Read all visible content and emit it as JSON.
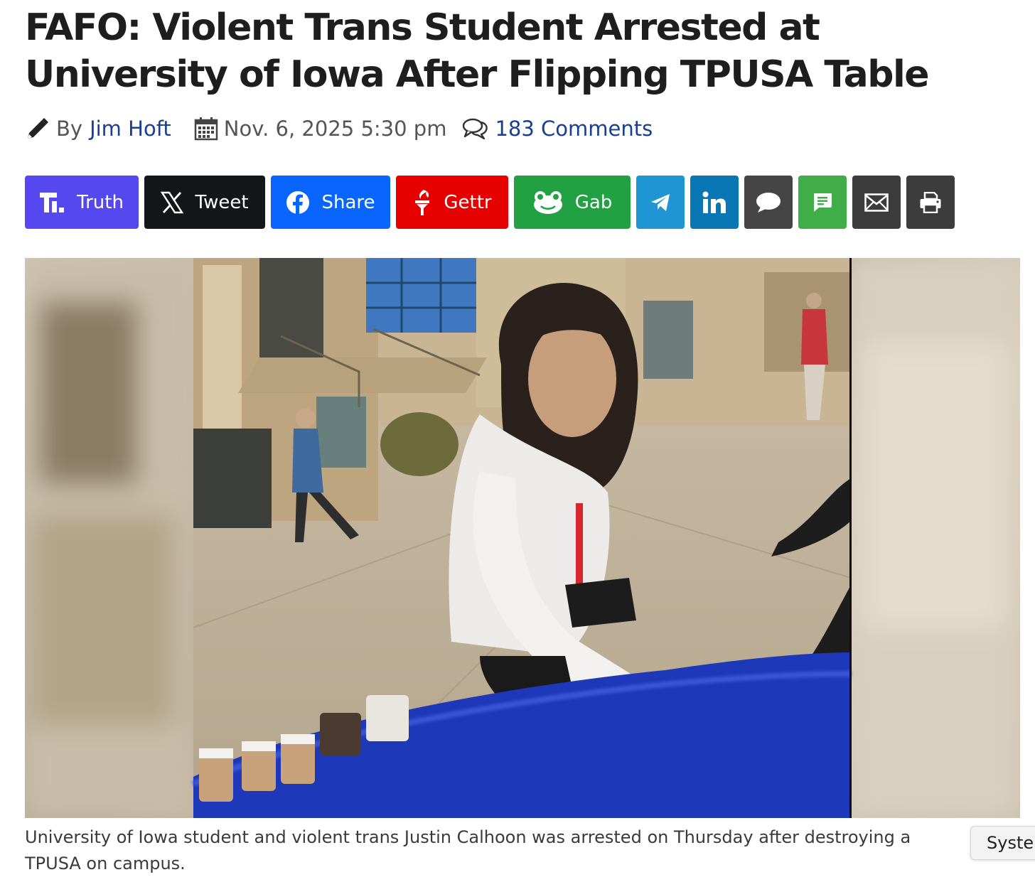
{
  "article": {
    "headline": "FAFO: Violent Trans Student Arrested at University of Iowa After Flipping TPUSA Table",
    "byline_prefix": "By",
    "author": "Jim Hoft",
    "date": "Nov. 6, 2025 5:30 pm",
    "comments": "183 Comments",
    "caption": "University of Iowa student and violent trans Justin Calhoon was arrested on Thursday after destroying a TPUSA on campus."
  },
  "share": {
    "buttons": [
      {
        "label": "Truth",
        "color": "#5448ee",
        "icon": "truth-social-icon"
      },
      {
        "label": "Tweet",
        "color": "#14171a",
        "icon": "x-icon"
      },
      {
        "label": "Share",
        "color": "#0866ff",
        "icon": "facebook-icon"
      },
      {
        "label": "Gettr",
        "color": "#e60000",
        "icon": "gettr-icon"
      },
      {
        "label": "Gab",
        "color": "#21a142",
        "icon": "gab-icon"
      }
    ],
    "icon_buttons": [
      {
        "name": "telegram",
        "color": "#1f96d3",
        "icon": "telegram-icon"
      },
      {
        "name": "linkedin",
        "color": "#0a77b5",
        "icon": "linkedin-icon"
      },
      {
        "name": "sms",
        "color": "#454545",
        "icon": "chat-bubble-icon"
      },
      {
        "name": "messages",
        "color": "#41ad49",
        "icon": "message-icon"
      },
      {
        "name": "email",
        "color": "#3c3c3c",
        "icon": "envelope-icon"
      },
      {
        "name": "print",
        "color": "#3c3c3c",
        "icon": "printer-icon"
      }
    ]
  },
  "system_badge": "System"
}
